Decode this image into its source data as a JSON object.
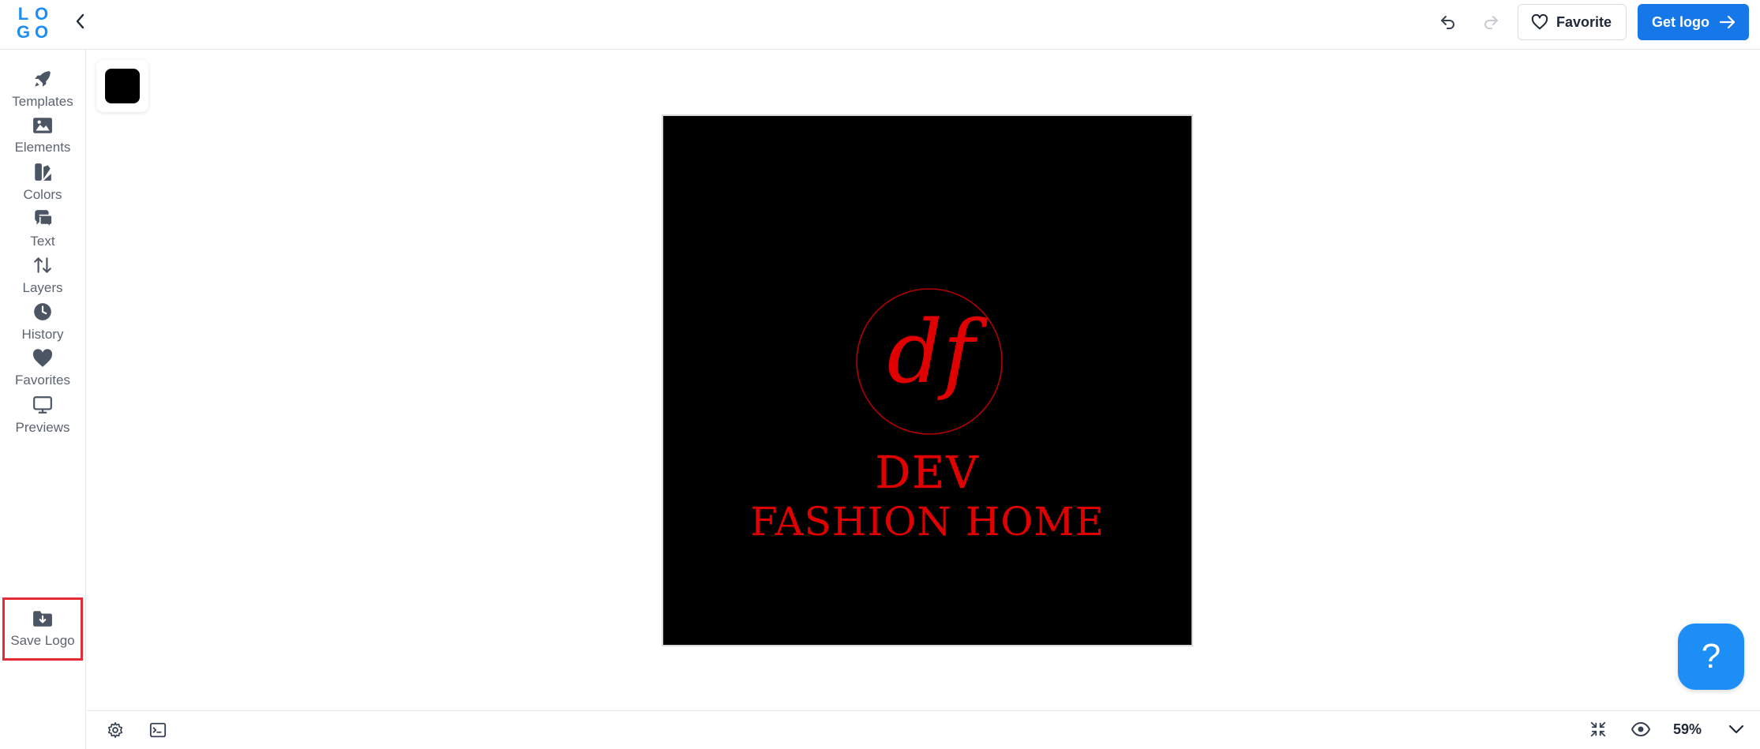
{
  "topbar": {
    "logo_letters": [
      "L",
      "O",
      "G",
      "O"
    ],
    "favorite_label": "Favorite",
    "get_logo_label": "Get logo"
  },
  "sidebar": {
    "items": [
      {
        "label": "Templates",
        "icon": "rocket-icon"
      },
      {
        "label": "Elements",
        "icon": "image-icon"
      },
      {
        "label": "Colors",
        "icon": "palette-icon"
      },
      {
        "label": "Text",
        "icon": "text-bubble-icon"
      },
      {
        "label": "Layers",
        "icon": "layers-arrows-icon"
      },
      {
        "label": "History",
        "icon": "clock-icon"
      },
      {
        "label": "Favorites",
        "icon": "heart-icon"
      },
      {
        "label": "Previews",
        "icon": "monitor-icon"
      },
      {
        "label": "Save Logo",
        "icon": "folder-download-icon",
        "highlighted": true
      }
    ]
  },
  "canvas": {
    "background_color": "#000000",
    "monogram": "df",
    "brand_line1": "DEV",
    "brand_line2": "FASHION HOME",
    "text_color": "#e00000"
  },
  "help": {
    "label": "?"
  },
  "bottombar": {
    "zoom": "59%"
  },
  "colors": {
    "accent": "#1677e8",
    "highlight": "#e52b33"
  }
}
